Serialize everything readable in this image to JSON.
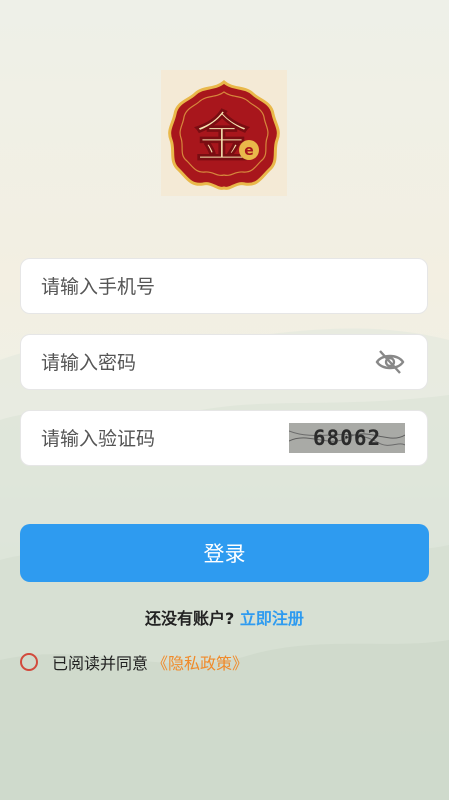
{
  "logo": {
    "glyph": "金",
    "sub": "e"
  },
  "form": {
    "phone_placeholder": "请输入手机号",
    "password_placeholder": "请输入密码",
    "captcha_placeholder": "请输入验证码",
    "captcha_text": "68062"
  },
  "login_label": "登录",
  "register": {
    "prompt": "还没有账户?",
    "link": "立即注册"
  },
  "agreement": {
    "text": "已阅读并同意",
    "policy": "《隐私政策》"
  },
  "colors": {
    "primary": "#2e9bf0",
    "policy": "#f08a2a",
    "radio": "#d24a3c",
    "logo_red": "#a8161c",
    "logo_gold": "#e9b84a"
  }
}
